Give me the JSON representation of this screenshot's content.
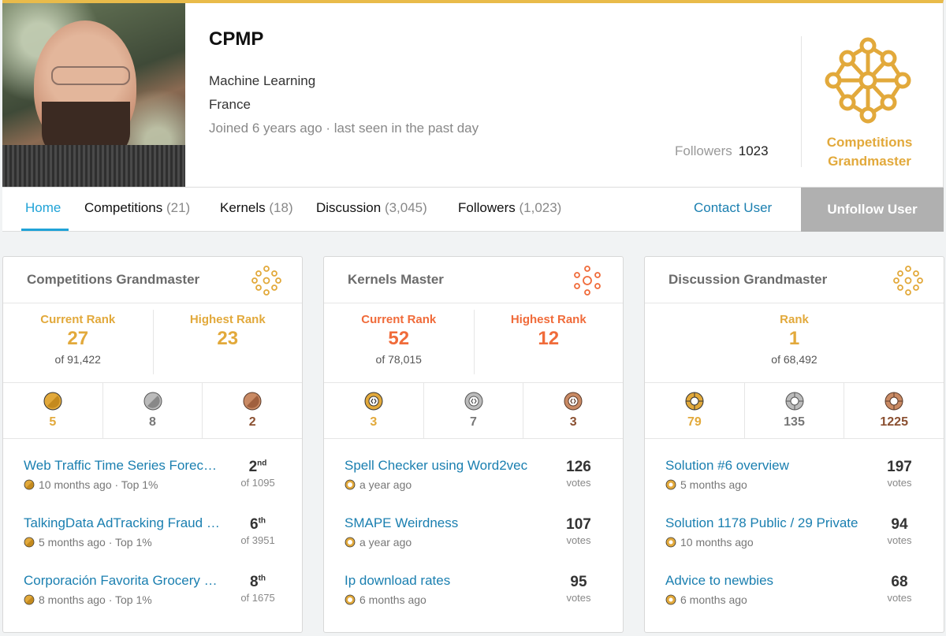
{
  "profile": {
    "name": "CPMP",
    "field": "Machine Learning",
    "location": "France",
    "joined": "Joined 6 years ago · last seen in the past day",
    "followers_label": "Followers",
    "followers_value": "1023",
    "tier_line1": "Competitions",
    "tier_line2": "Grandmaster"
  },
  "nav": {
    "tabs": [
      {
        "label": "Home",
        "count": ""
      },
      {
        "label": "Competitions",
        "count": "(21)"
      },
      {
        "label": "Kernels",
        "count": "(18)"
      },
      {
        "label": "Discussion",
        "count": "(3,045)"
      },
      {
        "label": "Followers",
        "count": "(1,023)"
      }
    ],
    "contact": "Contact User",
    "unfollow": "Unfollow User"
  },
  "colors": {
    "gold": "#e2a93b",
    "orange": "#f06b3a",
    "link": "#1a7fb0",
    "tab_active": "#20a3d7"
  },
  "cards": [
    {
      "title": "Competitions Grandmaster",
      "current_label": "Current Rank",
      "current_value": "27",
      "current_of": "of 91,422",
      "highest_label": "Highest Rank",
      "highest_value": "23",
      "medals": [
        "5",
        "8",
        "2"
      ],
      "items": [
        {
          "title": "Web Traffic Time Series Forecasting",
          "sub": "10 months ago · Top 1%",
          "big": "2",
          "sup": "nd",
          "small": "of 1095"
        },
        {
          "title": "TalkingData AdTracking Fraud Detection",
          "sub": "5 months ago · Top 1%",
          "big": "6",
          "sup": "th",
          "small": "of 3951"
        },
        {
          "title": "Corporación Favorita Grocery Sales",
          "sub": "8 months ago · Top 1%",
          "big": "8",
          "sup": "th",
          "small": "of 1675"
        }
      ]
    },
    {
      "title": "Kernels Master",
      "current_label": "Current Rank",
      "current_value": "52",
      "current_of": "of 78,015",
      "highest_label": "Highest Rank",
      "highest_value": "12",
      "medals": [
        "3",
        "7",
        "3"
      ],
      "items": [
        {
          "title": "Spell Checker using Word2vec",
          "sub": "a year ago",
          "big": "126",
          "small": "votes"
        },
        {
          "title": "SMAPE Weirdness",
          "sub": "a year ago",
          "big": "107",
          "small": "votes"
        },
        {
          "title": "Ip download rates",
          "sub": "6 months ago",
          "big": "95",
          "small": "votes"
        }
      ]
    },
    {
      "title": "Discussion Grandmaster",
      "rank_label": "Rank",
      "rank_value": "1",
      "rank_of": "of 68,492",
      "medals": [
        "79",
        "135",
        "1225"
      ],
      "items": [
        {
          "title": "Solution #6 overview",
          "sub": "5 months ago",
          "big": "197",
          "small": "votes"
        },
        {
          "title": "Solution 1178 Public / 29 Private",
          "sub": "10 months ago",
          "big": "94",
          "small": "votes"
        },
        {
          "title": "Advice to newbies",
          "sub": "6 months ago",
          "big": "68",
          "small": "votes"
        }
      ]
    }
  ]
}
